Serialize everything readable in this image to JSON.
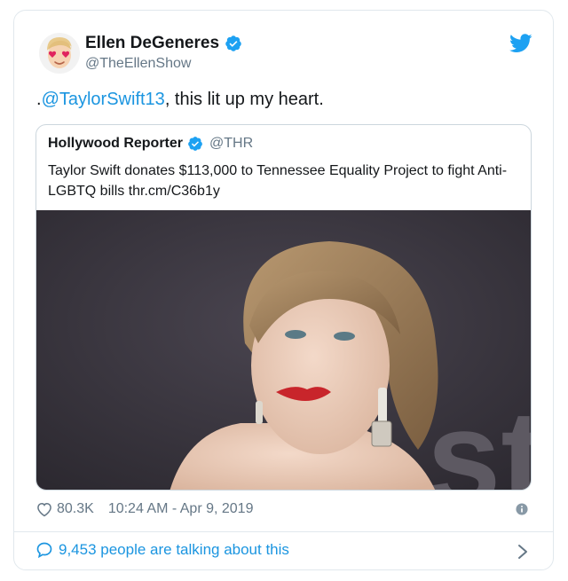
{
  "author": {
    "name": "Ellen DeGeneres",
    "handle": "@TheEllenShow"
  },
  "tweet": {
    "prefix": ".",
    "mention": "@TaylorSwift13",
    "text": ", this lit up my heart."
  },
  "quoted": {
    "name": "Hollywood Reporter",
    "handle": "@THR",
    "text": "Taylor Swift donates $113,000 to Tennessee Equality Project to fight Anti-LGBTQ bills thr.cm/C36b1y"
  },
  "meta": {
    "likes": "80.3K",
    "timestamp": "10:24 AM - Apr 9, 2019"
  },
  "footer": {
    "talking": "9,453 people are talking about this"
  },
  "colors": {
    "accent": "#1b95e0",
    "secondary_text": "#657786",
    "border": "#e1e8ed"
  },
  "icons": [
    "avatar-emoji-icon",
    "verified-badge-icon",
    "twitter-bird-icon",
    "heart-icon",
    "info-icon",
    "speech-bubble-icon",
    "chevron-right-icon"
  ]
}
